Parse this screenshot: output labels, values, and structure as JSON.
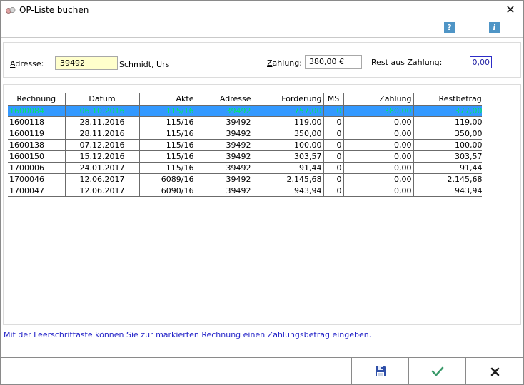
{
  "window": {
    "title": "OP-Liste buchen",
    "close_glyph": "✕"
  },
  "toolbar": {
    "help_glyph": "?",
    "info_glyph": "i"
  },
  "form": {
    "address_label_u": "A",
    "address_label_rest": "dresse:",
    "address_value": "39492",
    "address_name": "Schmidt, Urs",
    "payment_label_u": "Z",
    "payment_label_rest": "ahlung:",
    "payment_value": "380,00 €",
    "rest_label": "Rest aus Zahlung:",
    "rest_value": "0,00"
  },
  "table": {
    "headers": [
      "Rechnung",
      "Datum",
      "Akte",
      "Adresse",
      "Forderung",
      "MS",
      "Zahlung",
      "Restbetrag"
    ],
    "rows": [
      [
        "1600084",
        "06.10.2016",
        "115/16",
        "39492",
        "757,00",
        "0",
        "380,00",
        "377,00"
      ],
      [
        "1600118",
        "28.11.2016",
        "115/16",
        "39492",
        "119,00",
        "0",
        "0,00",
        "119,00"
      ],
      [
        "1600119",
        "28.11.2016",
        "115/16",
        "39492",
        "350,00",
        "0",
        "0,00",
        "350,00"
      ],
      [
        "1600138",
        "07.12.2016",
        "115/16",
        "39492",
        "100,00",
        "0",
        "0,00",
        "100,00"
      ],
      [
        "1600150",
        "15.12.2016",
        "115/16",
        "39492",
        "303,57",
        "0",
        "0,00",
        "303,57"
      ],
      [
        "1700006",
        "24.01.2017",
        "115/16",
        "39492",
        "91,44",
        "0",
        "0,00",
        "91,44"
      ],
      [
        "1700046",
        "12.06.2017",
        "6089/16",
        "39492",
        "2.145,68",
        "0",
        "0,00",
        "2.145,68"
      ],
      [
        "1700047",
        "12.06.2017",
        "6090/16",
        "39492",
        "943,94",
        "0",
        "0,00",
        "943,94"
      ]
    ],
    "selected_row": 0,
    "colors": {
      "selection_bg": "#3399ff",
      "selection_text": "#00e86a"
    }
  },
  "hint": "Mit der Leerschrittaste können Sie zur markierten Rechnung einen Zahlungsbetrag eingeben.",
  "buttons": {
    "save_icon": "floppy-disk-icon",
    "ok_icon": "checkmark-icon",
    "cancel_icon": "cross-icon"
  },
  "colors": {
    "hint_text": "#2424c8",
    "address_field_bg": "#ffffcc",
    "icon_blue": "#4f95c6",
    "check_green": "#3a9a6a"
  }
}
